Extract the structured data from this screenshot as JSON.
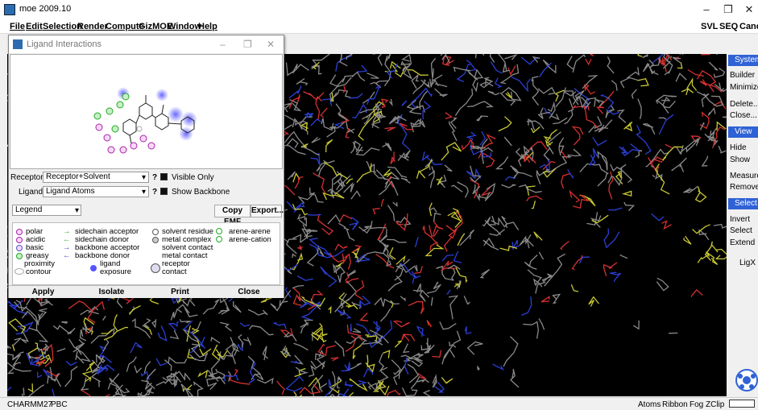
{
  "app": {
    "title": "moe 2009.10",
    "minimize_glyph": "–",
    "restore_glyph": "❐",
    "close_glyph": "✕"
  },
  "menu": [
    "File",
    "Edit",
    "Selection",
    "Render",
    "Compute",
    "GizMOE",
    "Window",
    "Help"
  ],
  "menu_right": {
    "svl": "SVL",
    "seq": "SEQ",
    "cancel": "Cance"
  },
  "right_panel": {
    "system": "System",
    "builder": "Builder",
    "minimize": "Minimize",
    "delete": "Delete...",
    "close": "Close...",
    "view": "View",
    "hide": "Hide",
    "show": "Show",
    "measure": "Measure",
    "remove": "Remove",
    "select_hdr": "Select",
    "invert": "Invert",
    "select": "Select",
    "extend": "Extend",
    "ligx": "LigX"
  },
  "status": {
    "left1": "CHARMM27",
    "left2": "PBC",
    "right": [
      "Atoms",
      "Ribbon",
      "Fog",
      "ZClip"
    ]
  },
  "dialog": {
    "title": "Ligand Interactions",
    "receptor_label": "Receptor:",
    "receptor_value": "Receptor+Solvent",
    "ligand_label": "Ligand:",
    "ligand_value": "Ligand Atoms",
    "visible_only": "Visible Only",
    "show_backbone": "Show Backbone",
    "help": "?",
    "legend_value": "Legend",
    "copy_emf": "Copy EMF",
    "export": "Export...",
    "legend": {
      "polar": "polar",
      "acidic": "acidic",
      "basic": "basic",
      "greasy": "greasy",
      "proximity": "proximity",
      "contour": "contour",
      "sc_acceptor": "sidechain acceptor",
      "sc_donor": "sidechain donor",
      "bb_acceptor": "backbone acceptor",
      "bb_donor": "backbone donor",
      "ligand": "ligand",
      "exposure": "exposure",
      "solvent_residue": "solvent residue",
      "metal_complex": "metal complex",
      "solvent_contact": "solvent contact",
      "metal_contact": "metal contact",
      "receptor": "receptor",
      "contact": "contact",
      "arene_arene": "arene-arene",
      "arene_cation": "arene-cation"
    },
    "buttons": [
      "Apply",
      "Isolate",
      "Print",
      "Close"
    ]
  },
  "colors": {
    "accent": "#2f62d6",
    "viewport": "#000000"
  }
}
